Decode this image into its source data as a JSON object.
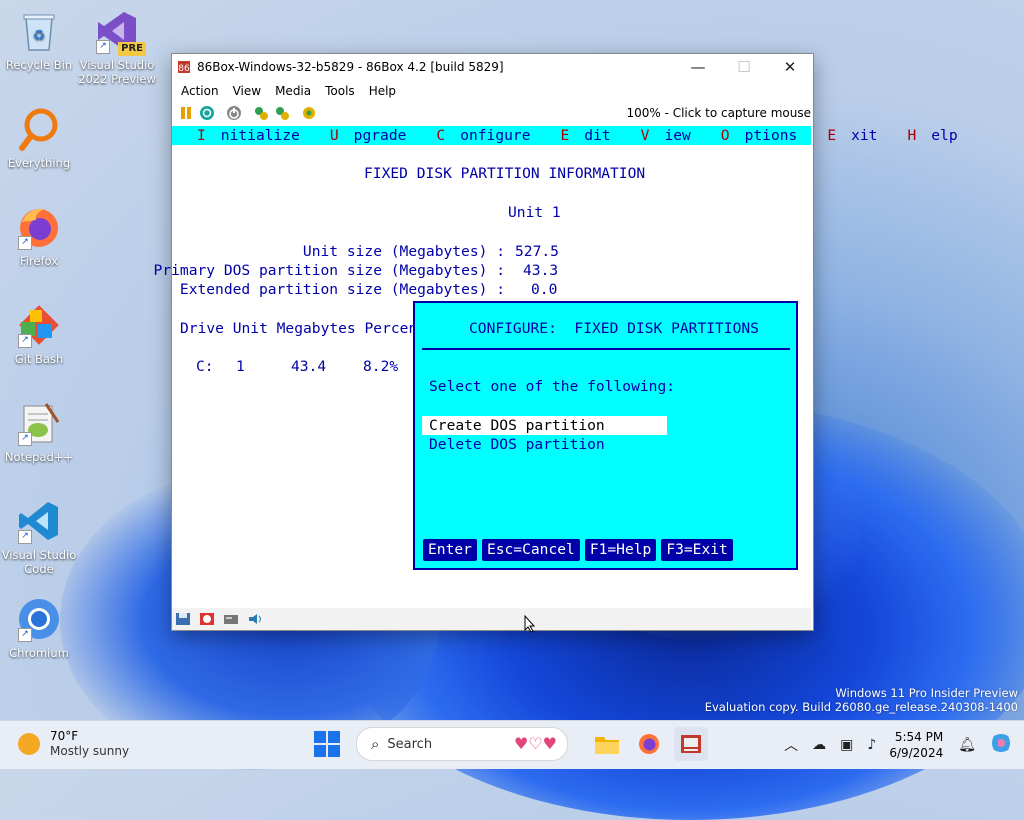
{
  "desktop": {
    "icons": [
      {
        "label": "Recycle Bin"
      },
      {
        "label": "Visual Studio 2022 Preview",
        "badge": "PRE"
      },
      {
        "label": "Everything"
      },
      {
        "label": "Firefox"
      },
      {
        "label": "Git Bash"
      },
      {
        "label": "Notepad++"
      },
      {
        "label": "Visual Studio Code"
      },
      {
        "label": "Chromium"
      }
    ],
    "watermark": {
      "line1": "Windows 11 Pro Insider Preview",
      "line2": "Evaluation copy. Build 26080.ge_release.240308-1400"
    }
  },
  "window": {
    "title": "86Box-Windows-32-b5829 - 86Box 4.2 [build 5829]",
    "controls": {
      "minimize": "—",
      "maximize": "☐",
      "close": "✕"
    },
    "menu": [
      "Action",
      "View",
      "Media",
      "Tools",
      "Help"
    ],
    "capture_text": "100% - Click to capture mouse"
  },
  "dos": {
    "menu": [
      {
        "hk": "I",
        "rest": "nitialize"
      },
      {
        "hk": "U",
        "rest": "pgrade"
      },
      {
        "hk": "C",
        "rest": "onfigure"
      },
      {
        "hk": "E",
        "rest": "dit"
      },
      {
        "hk": "V",
        "rest": "iew"
      },
      {
        "hk": "O",
        "rest": "ptions"
      },
      {
        "hk": "E",
        "rest": "xit"
      },
      {
        "hk": "H",
        "rest": "elp"
      }
    ],
    "heading": "FIXED DISK PARTITION INFORMATION",
    "unit": "Unit 1",
    "unit_size_label": "Unit size (Megabytes) :",
    "unit_size_value": "527.5",
    "primary_label": "Primary DOS partition size (Megabytes) :",
    "primary_value": "43.3",
    "extended_label": "Extended partition size (Megabytes) :",
    "extended_value": "0.0",
    "table_header": "Drive Unit Megabytes Percent",
    "table_row": {
      "drive": "C:",
      "unit": "1",
      "mb": "43.4",
      "pct": "8.2%"
    },
    "dialog": {
      "title": "CONFIGURE:  FIXED DISK PARTITIONS",
      "prompt": "Select one of the following:",
      "options": [
        "Create DOS partition",
        "Delete DOS partition"
      ],
      "fkeys": [
        "Enter",
        "Esc=Cancel",
        "F1=Help",
        "F3=Exit"
      ]
    }
  },
  "taskbar": {
    "weather_temp": "70°F",
    "weather_desc": "Mostly sunny",
    "search_label": "Search",
    "time": "5:54 PM",
    "date": "6/9/2024"
  }
}
